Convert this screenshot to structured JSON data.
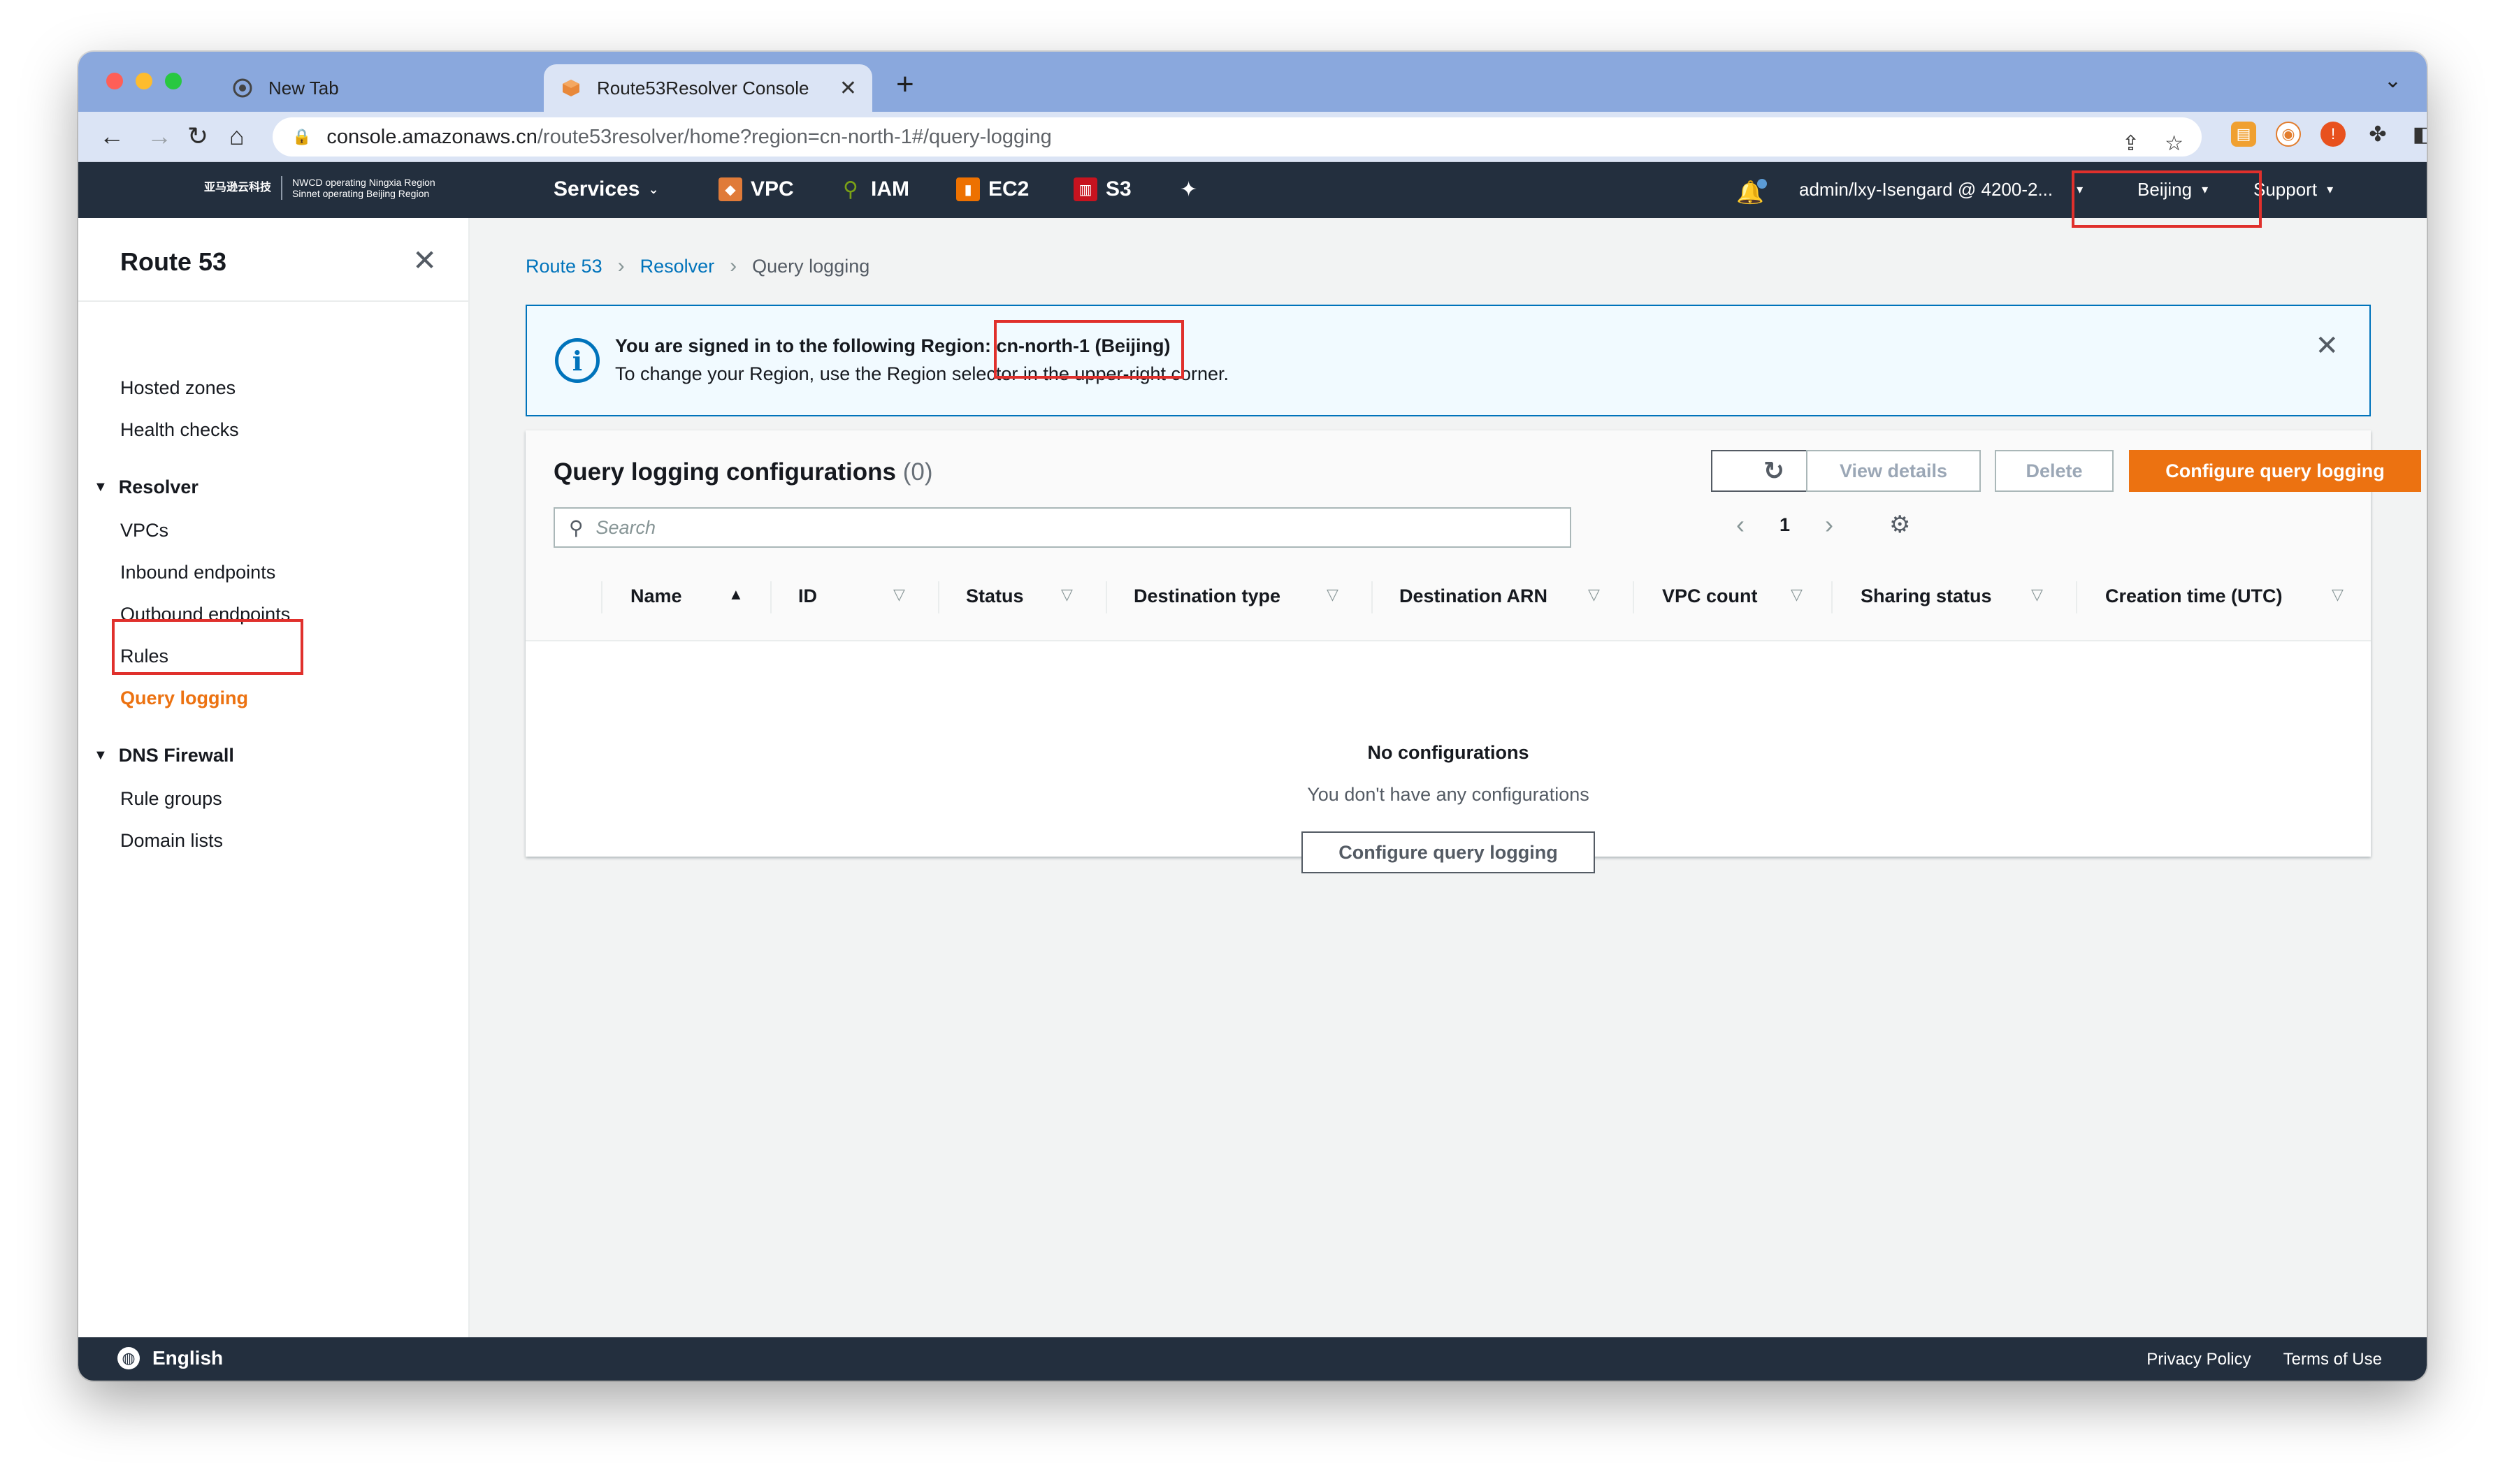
{
  "browser": {
    "tabs": [
      {
        "title": "New Tab",
        "icon": "chrome-icon"
      },
      {
        "title": "Route53Resolver Console",
        "icon": "aws-cube-icon"
      }
    ],
    "url_host": "console.amazonaws.cn",
    "url_path": "/route53resolver/home?region=cn-north-1#/query-logging"
  },
  "aws_nav": {
    "logo_line1": "NWCD operating Ningxia Region",
    "logo_line2": "Sinnet operating Beijing Region",
    "logo_cn": "亚马逊云科技",
    "services_label": "Services",
    "shortcuts": [
      {
        "label": "VPC",
        "color": "#e07b39"
      },
      {
        "label": "IAM",
        "color": "#7aa116"
      },
      {
        "label": "EC2",
        "color": "#ed7100"
      },
      {
        "label": "S3",
        "color": "#c7131f"
      }
    ],
    "account": "admin/lxy-Isengard @ 4200-2...",
    "region": "Beijing",
    "support": "Support"
  },
  "sidebar": {
    "title": "Route 53",
    "top_links": [
      "Hosted zones",
      "Health checks"
    ],
    "resolver_label": "Resolver",
    "resolver_links": [
      "VPCs",
      "Inbound endpoints",
      "Outbound endpoints",
      "Rules",
      "Query logging"
    ],
    "firewall_label": "DNS Firewall",
    "firewall_links": [
      "Rule groups",
      "Domain lists"
    ]
  },
  "breadcrumb": [
    "Route 53",
    "Resolver",
    "Query logging"
  ],
  "flash": {
    "line1_prefix": "You are signed in to the following Region: ",
    "region": "cn-north-1 (Beijing)",
    "line2": "To change your Region, use the Region selector in the upper-right corner."
  },
  "panel": {
    "title": "Query logging configurations",
    "count": "(0)",
    "view_details": "View details",
    "delete": "Delete",
    "configure": "Configure query logging",
    "search_placeholder": "Search",
    "page": "1",
    "columns": [
      "Name",
      "ID",
      "Status",
      "Destination type",
      "Destination ARN",
      "VPC count",
      "Sharing status",
      "Creation time (UTC)"
    ],
    "empty_title": "No configurations",
    "empty_sub": "You don't have any configurations",
    "empty_button": "Configure query logging"
  },
  "footer": {
    "language": "English",
    "privacy": "Privacy Policy",
    "terms": "Terms of Use"
  },
  "colors": {
    "aws_orange": "#ec7211",
    "aws_nav": "#232f3e",
    "link_blue": "#0073bb",
    "highlight_red": "#e0302c"
  }
}
